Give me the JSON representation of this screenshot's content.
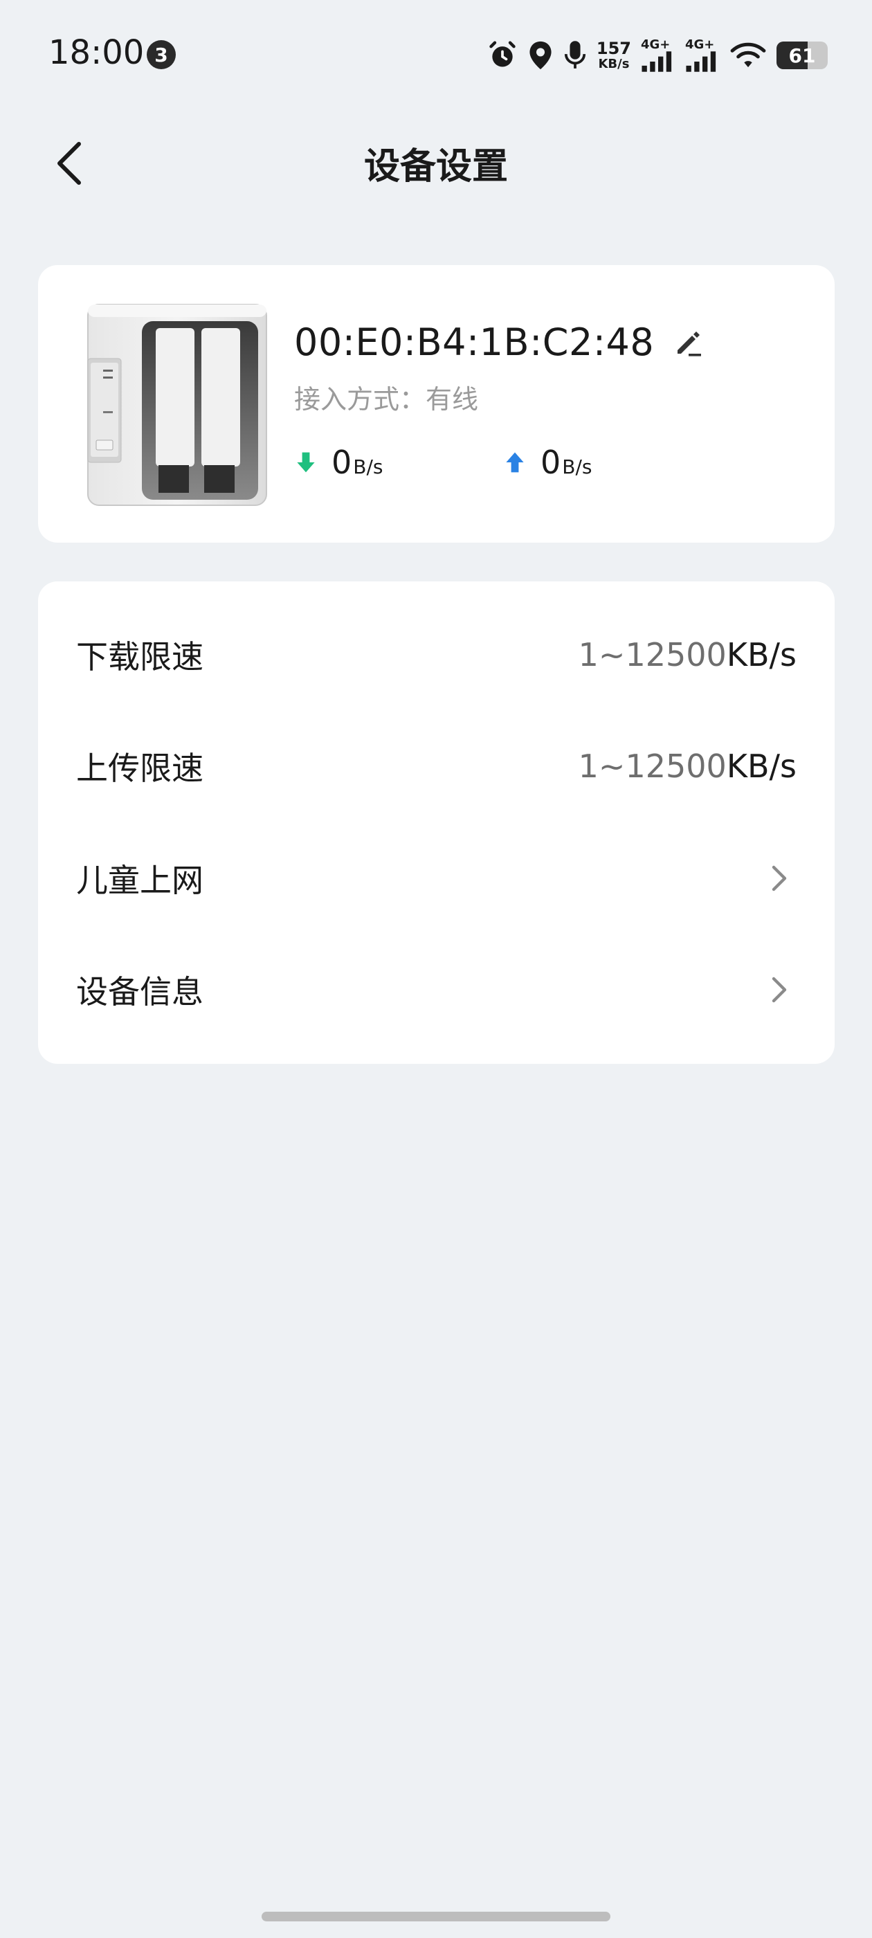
{
  "status_bar": {
    "time": "18:00",
    "notification_count": "3",
    "net_speed_value": "157",
    "net_speed_unit": "KB/s",
    "sim1_label": "4G+",
    "sim2_label": "4G+",
    "battery_level": "61",
    "icons": [
      "alarm-icon",
      "location-icon",
      "microphone-icon",
      "signal-icon",
      "wifi-icon",
      "battery-icon"
    ]
  },
  "header": {
    "title": "设备设置",
    "back_icon": "chevron-left-icon"
  },
  "device": {
    "mac": "00:E0:B4:1B:C2:48",
    "connection": "接入方式：有线",
    "download_value": "0",
    "download_unit": "B/s",
    "upload_value": "0",
    "upload_unit": "B/s",
    "colors": {
      "download_arrow": "#1fbf7f",
      "upload_arrow": "#2a82e4"
    }
  },
  "settings": {
    "download_limit": {
      "label": "下载限速",
      "range": "1~12500",
      "unit": "KB/s"
    },
    "upload_limit": {
      "label": "上传限速",
      "range": "1~12500",
      "unit": "KB/s"
    },
    "child_internet": {
      "label": "儿童上网"
    },
    "device_info": {
      "label": "设备信息"
    }
  },
  "colors": {
    "background": "#eef1f4",
    "card": "#ffffff"
  }
}
